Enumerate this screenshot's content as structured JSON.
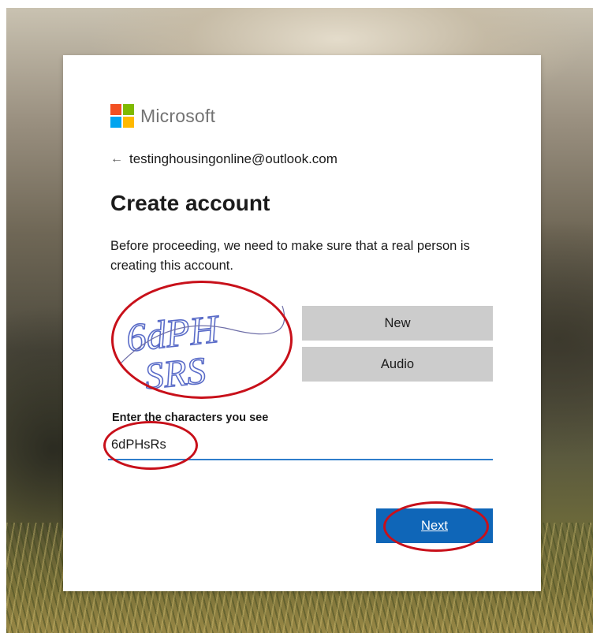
{
  "brand": {
    "name": "Microsoft",
    "logo_colors": [
      "#f25022",
      "#7fba00",
      "#00a4ef",
      "#ffb900"
    ]
  },
  "identity": {
    "back_icon": "back-arrow-icon",
    "email": "testinghousingonline@outlook.com"
  },
  "form": {
    "title": "Create account",
    "description": "Before proceeding, we need to make sure that a real person is creating this account.",
    "captcha": {
      "line1": "6dPH",
      "line2": "SRS",
      "new_label": "New",
      "audio_label": "Audio"
    },
    "input_label": "Enter the characters you see",
    "input_value": "6dPHsRs",
    "next_label": "Next"
  },
  "colors": {
    "primary_button": "#0f66b8",
    "input_underline": "#2f7ecb",
    "secondary_button": "#cccccc",
    "annotation": "#c8101a"
  }
}
